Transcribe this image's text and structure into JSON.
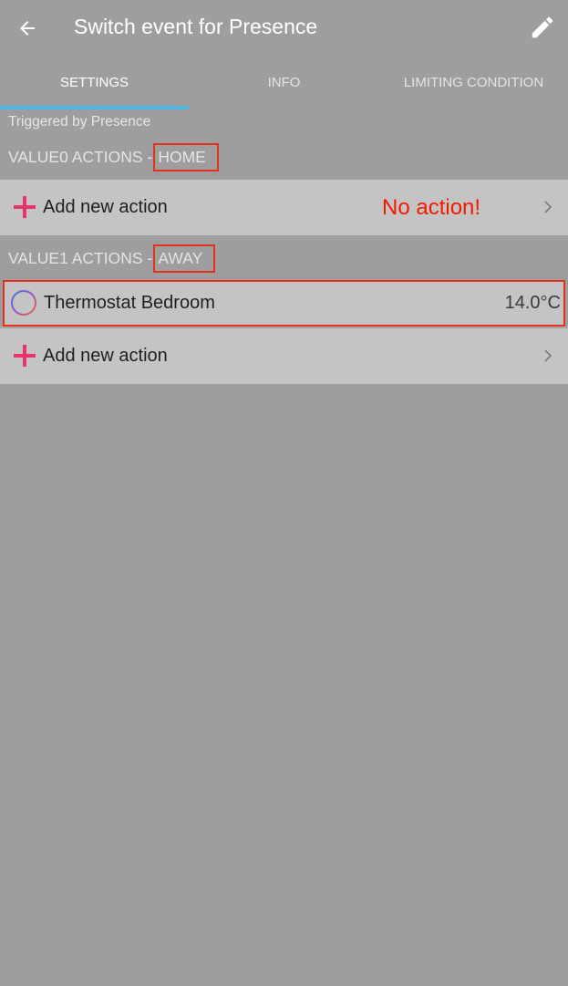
{
  "appbar": {
    "title": "Switch event for Presence",
    "back_icon": "arrow-left-icon",
    "edit_icon": "pencil-icon"
  },
  "tabs": [
    {
      "label": "SETTINGS",
      "active": true
    },
    {
      "label": "INFO",
      "active": false
    },
    {
      "label": "LIMITING CONDITION",
      "active": false
    }
  ],
  "triggered_by": "Triggered by Presence",
  "sections": [
    {
      "header_prefix": "VALUE0 ACTIONS",
      "header_dash": "-",
      "header_value": "HOME",
      "add_action_label": "Add new action",
      "annotation": "No action!"
    },
    {
      "header_prefix": "VALUE1 ACTIONS",
      "header_dash": "-",
      "header_value": "AWAY",
      "device": {
        "name": "Thermostat Bedroom",
        "value": "14.0°C"
      },
      "add_action_label": "Add new action"
    }
  ],
  "colors": {
    "background": "#9e9e9e",
    "row_background": "#c4c4c4",
    "accent_tab": "#4fb8e6",
    "plus": "#e8336b",
    "highlight_box": "#e5321c",
    "annotation_text": "#f21a00"
  }
}
